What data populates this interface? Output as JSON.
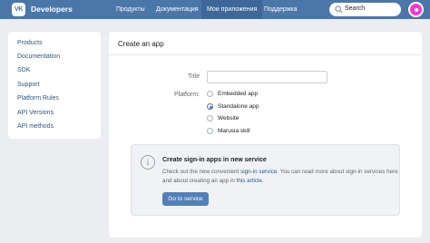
{
  "header": {
    "logo_text": "VK",
    "brand": "Developers",
    "nav": [
      {
        "label": "Продукты"
      },
      {
        "label": "Документация"
      },
      {
        "label": "Мои приложения"
      },
      {
        "label": "Поддержка"
      }
    ],
    "active_nav": "Мои приложения",
    "search_placeholder": "Search",
    "accent_color": "#4a76a8",
    "search_icon": "search-icon"
  },
  "sidebar": {
    "items": [
      {
        "label": "Products"
      },
      {
        "label": "Documentation"
      },
      {
        "label": "SDK"
      },
      {
        "label": "Support"
      },
      {
        "label": "Platform Rules"
      },
      {
        "label": "API Versions"
      },
      {
        "label": "API methods"
      }
    ]
  },
  "main": {
    "title": "Create an app",
    "form": {
      "title_label": "Title",
      "title_value": "",
      "platform_label": "Platform:",
      "platforms": [
        {
          "label": "Embedded app",
          "checked": false
        },
        {
          "label": "Standalone app",
          "checked": true
        },
        {
          "label": "Website",
          "checked": false
        },
        {
          "label": "Marusia skill",
          "checked": false
        }
      ]
    },
    "info": {
      "icon": "info-icon",
      "title": "Create sign-in apps in new service",
      "text_1": "Check out the new convenient ",
      "link_1": "sign-in service",
      "text_2": ". You can read more about sign-in services here and about creating an app in ",
      "link_2": "this article",
      "text_3": ".",
      "button": "Go to service"
    }
  }
}
